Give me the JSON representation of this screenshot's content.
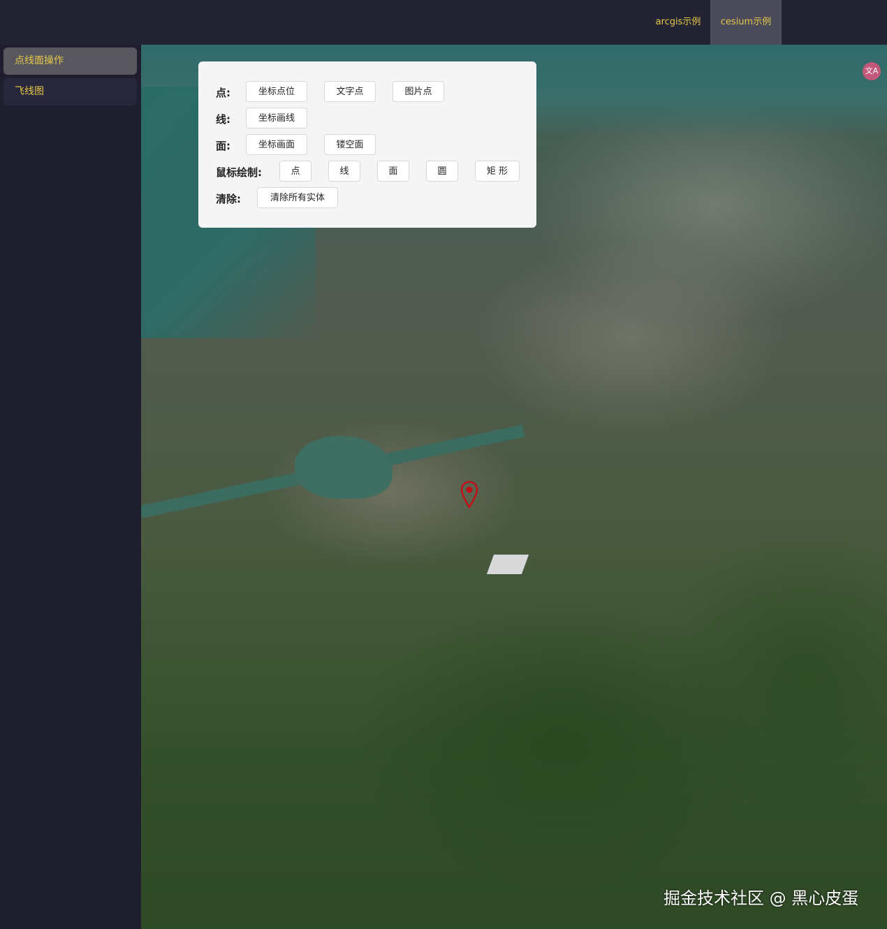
{
  "topnav": {
    "tabs": [
      {
        "label": "arcgis示例"
      },
      {
        "label": "cesium示例",
        "active": true
      }
    ]
  },
  "sidebar": {
    "items": [
      {
        "label": "点线面操作",
        "active": true
      },
      {
        "label": "飞线图"
      }
    ]
  },
  "panel": {
    "point": {
      "label": "点:",
      "buttons": [
        "坐标点位",
        "文字点",
        "图片点"
      ]
    },
    "line": {
      "label": "线:",
      "buttons": [
        "坐标画线"
      ]
    },
    "polygon": {
      "label": "面:",
      "buttons": [
        "坐标画面",
        "镂空面"
      ]
    },
    "mouse_draw": {
      "label": "鼠标绘制:",
      "buttons": [
        "点",
        "线",
        "面",
        "圆",
        "矩 形"
      ]
    },
    "clear": {
      "label": "清除:",
      "buttons": [
        "清除所有实体"
      ]
    }
  },
  "map": {
    "marker_icon": "map-pin-icon",
    "translate_icon": "translate-icon",
    "watermark": "掘金技术社区 @ 黑心皮蛋"
  },
  "colors": {
    "accent_text": "#e6c94a",
    "topbar_bg": "#232334",
    "sidebar_active_bg": "#58575f",
    "marker": "#c0101a"
  }
}
